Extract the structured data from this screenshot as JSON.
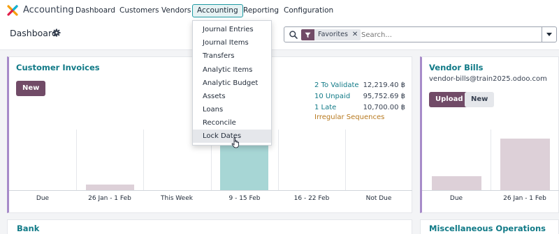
{
  "nav": {
    "app_name": "Accounting",
    "items": [
      {
        "label": "Dashboard"
      },
      {
        "label": "Customers"
      },
      {
        "label": "Vendors"
      },
      {
        "label": "Accounting"
      },
      {
        "label": "Reporting"
      },
      {
        "label": "Configuration"
      }
    ],
    "active": "Accounting"
  },
  "control": {
    "title": "Dashboard",
    "search": {
      "facet_label": "Favorites",
      "placeholder": "Search..."
    }
  },
  "accounting_menu": {
    "items": [
      {
        "label": "Journal Entries"
      },
      {
        "label": "Journal Items"
      },
      {
        "label": "Transfers"
      },
      {
        "label": "Analytic Items"
      },
      {
        "label": "Analytic Budget"
      },
      {
        "label": "Assets"
      },
      {
        "label": "Loans"
      },
      {
        "label": "Reconcile"
      },
      {
        "label": "Lock Dates"
      }
    ],
    "hovered": "Lock Dates"
  },
  "customer_invoices": {
    "title": "Customer Invoices",
    "new_label": "New",
    "stats": [
      {
        "label": "2 To Validate",
        "value": "12,219.40 ฿"
      },
      {
        "label": "10 Unpaid",
        "value": "95,752.69 ฿"
      },
      {
        "label": "1 Late",
        "value": "10,700.00 ฿"
      }
    ],
    "irregular_label": "Irregular Sequences"
  },
  "vendor_bills": {
    "title": "Vendor Bills",
    "email": "vendor-bills@train2025.odoo.com",
    "upload_label": "Upload",
    "new_label": "New"
  },
  "bank": {
    "title": "Bank"
  },
  "misc": {
    "title": "Miscellaneous Operations"
  },
  "colors": {
    "brand": "#714b67",
    "accent_teal": "#117a87",
    "bar_normal": "#ddd0d8",
    "bar_current": "#a7d6d5",
    "warning": "#b7791f"
  },
  "chart_data": [
    {
      "type": "bar",
      "title": "",
      "categories": [
        "Due",
        "26 Jan - 1 Feb",
        "This Week",
        "9 - 15 Feb",
        "16 - 22 Feb",
        "Not Due"
      ],
      "values": [
        0,
        9,
        0,
        85,
        0,
        0
      ],
      "highlight": "9 - 15 Feb",
      "ylim": [
        0,
        100
      ],
      "grid": true
    },
    {
      "type": "bar",
      "title": "",
      "categories": [
        "Due",
        "26 Jan - 1 Feb"
      ],
      "values": [
        23,
        85
      ],
      "ylim": [
        0,
        100
      ],
      "grid": true
    }
  ]
}
